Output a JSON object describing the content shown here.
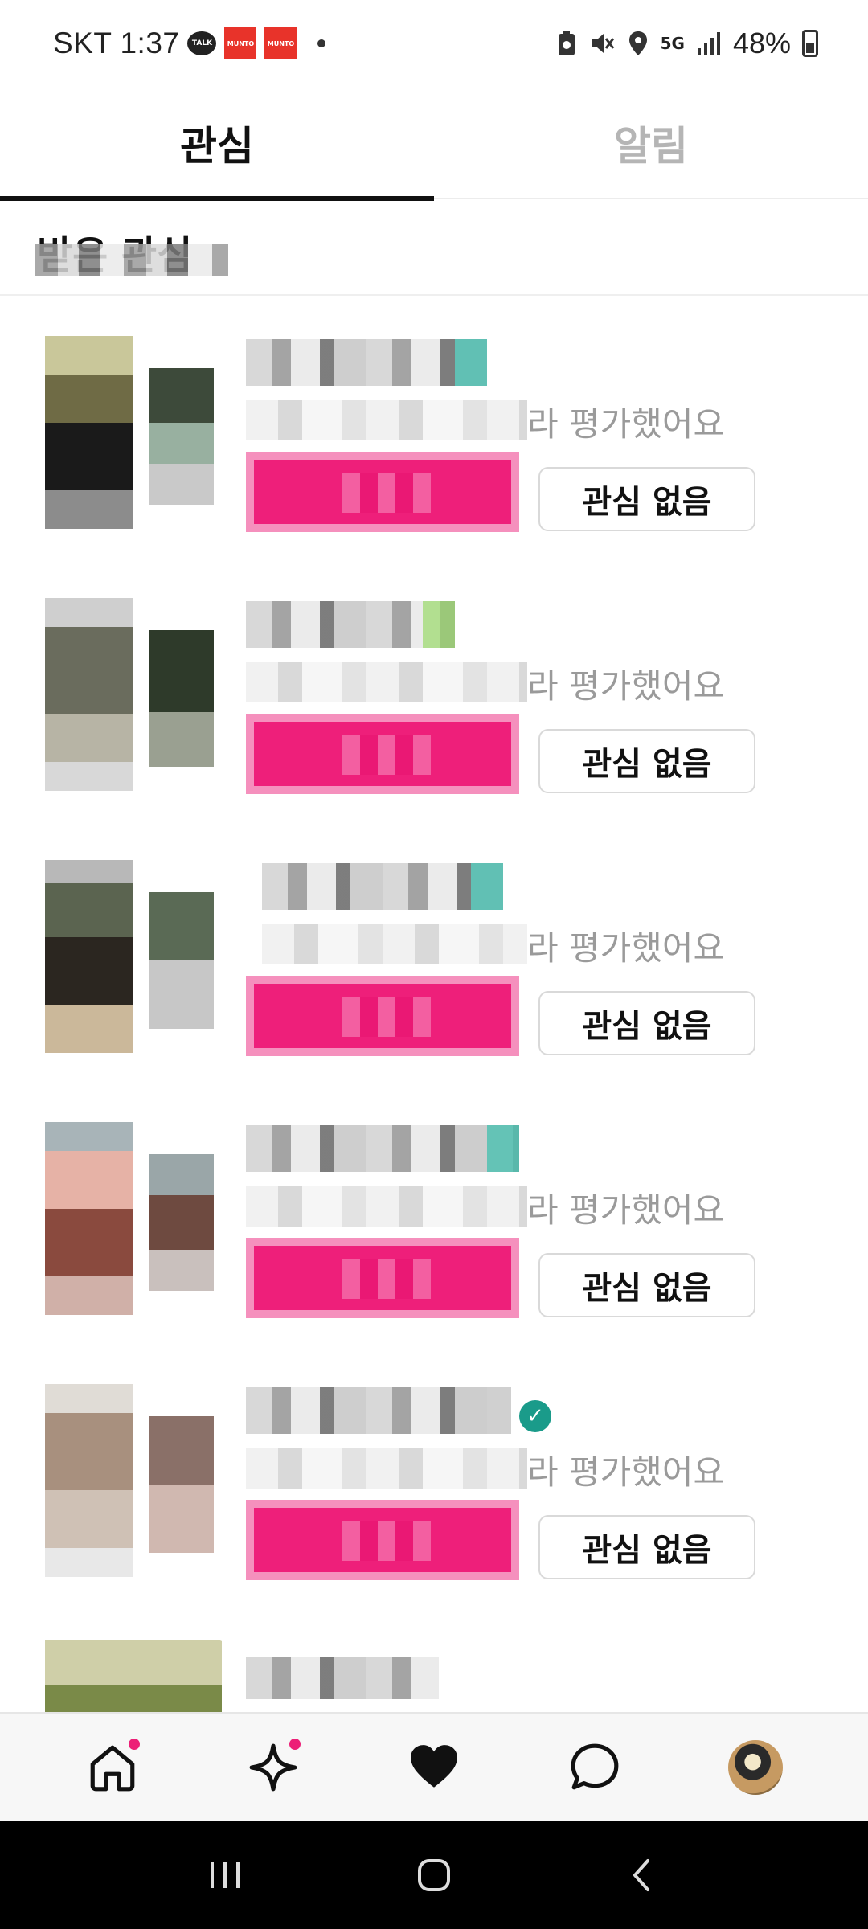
{
  "status_bar": {
    "carrier": "SKT",
    "time": "1:37",
    "talk_label": "TALK",
    "munto_label_1": "MUNTO",
    "munto_label_2": "MUNTO",
    "network": "5G",
    "battery": "48%"
  },
  "tabs": [
    {
      "label": "관심",
      "active": true
    },
    {
      "label": "알림",
      "active": false
    }
  ],
  "section": {
    "title": "받은 관심"
  },
  "items": [
    {
      "desc_suffix": "라 평가했어요",
      "button_label": "관심 없음"
    },
    {
      "desc_suffix": "라 평가했어요",
      "button_label": "관심 없음"
    },
    {
      "desc_suffix": "라 평가했어요",
      "button_label": "관심 없음"
    },
    {
      "desc_suffix": "라 평가했어요",
      "button_label": "관심 없음"
    },
    {
      "desc_suffix": "라 평가했어요",
      "button_label": "관심 없음"
    }
  ],
  "colors": {
    "accent_pink": "#ee1f7a",
    "badge_pink": "#ec1f77",
    "verified_teal": "#1a9b8a"
  },
  "bottom_nav": {
    "items": [
      {
        "icon": "home-icon",
        "badge": true
      },
      {
        "icon": "sparkle-icon",
        "badge": true
      },
      {
        "icon": "heart-icon",
        "badge": false
      },
      {
        "icon": "chat-bubble-icon",
        "badge": false
      },
      {
        "icon": "profile-avatar",
        "badge": false
      }
    ]
  },
  "android_nav": [
    "recent-apps-icon",
    "home-circle-icon",
    "back-icon"
  ]
}
